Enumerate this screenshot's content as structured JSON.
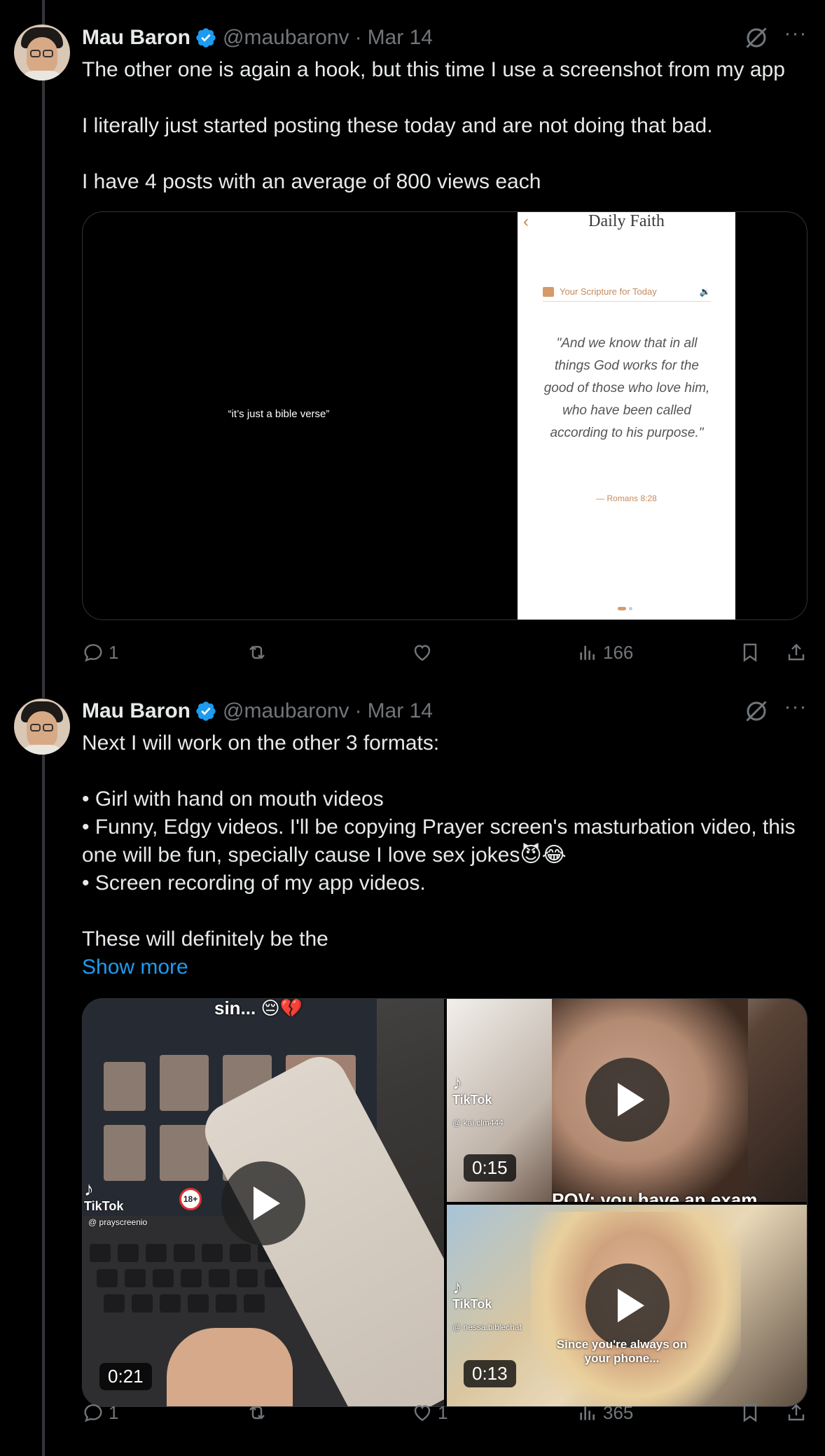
{
  "tweets": [
    {
      "author": {
        "name": "Mau Baron",
        "handle": "@maubaronv",
        "date": "Mar 14"
      },
      "text": [
        "The other one is again a hook, but this time I use a screenshot from my app",
        "",
        "I literally just started posting these today and are not doing that bad.",
        "",
        "I have 4 posts with an average of 800 views each"
      ],
      "media": {
        "hook_text": "“it’s just a bible verse”",
        "app": {
          "back": "‹",
          "title": "Daily Faith",
          "section": "Your Scripture for Today",
          "speaker": "🔉",
          "verse": "\"And we know that in all things God works for the good of those who love him, who have been called according to his purpose.\"",
          "reference": "— Romans 8:28"
        }
      },
      "actions": {
        "replies": "1",
        "reposts": "",
        "likes": "",
        "views": "166"
      }
    },
    {
      "author": {
        "name": "Mau Baron",
        "handle": "@maubaronv",
        "date": "Mar 14"
      },
      "text": [
        "Next I will work on the other 3 formats:",
        "",
        "• Girl with hand on mouth videos",
        "• Funny, Edgy videos. I'll be copying Prayer screen's masturbation video, this one will be fun, specially cause I love sex jokes😈😂",
        "• Screen recording of my app videos.",
        "",
        "These will definitely be the"
      ],
      "show_more": "Show more",
      "videos": [
        {
          "duration": "0:21",
          "tiktok": "TikTok",
          "tiktok_handle": "@ prayscreenio",
          "caption": "sin... 😔💔",
          "badge": "18+"
        },
        {
          "duration": "0:15",
          "tiktok": "TikTok",
          "tiktok_handle": "@ kai.clm444",
          "caption": "POV: you have an exam"
        },
        {
          "duration": "0:13",
          "tiktok": "TikTok",
          "tiktok_handle": "@ nessa.biblechat",
          "caption": "Since you're always on your phone..."
        }
      ],
      "actions": {
        "replies": "1",
        "reposts": "",
        "likes": "1",
        "views": "365"
      }
    }
  ],
  "colors": {
    "accent": "#1d9bf0",
    "muted": "#71767b",
    "text": "#e7e9ea",
    "background": "#000000"
  },
  "icons": [
    "verified-badge-icon",
    "grok-icon",
    "more-icon",
    "reply-icon",
    "repost-icon",
    "like-icon",
    "views-icon",
    "bookmark-icon",
    "share-icon",
    "play-icon",
    "tiktok-icon"
  ]
}
